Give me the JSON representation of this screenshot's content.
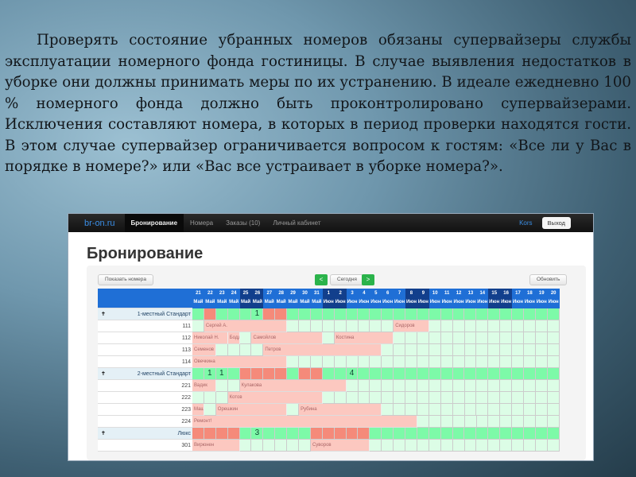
{
  "slide": {
    "paragraph": "Проверять состояние убранных номеров обязаны супервайзеры службы эксплуатации номерного фонда гостиницы. В случае выявления недостатков в уборке они должны принимать меры по их устранению. В идеале ежедневно 100 % номерного фонда должно быть проконтролировано супервайзерами. Исключения составляют номера, в которых в период проверки находятся гости. В этом случае супервайзер ограничивается вопросом к гостям: «Все ли у Вас в порядке в номере?» или «Вас все устраивает в уборке номера?»."
  },
  "app": {
    "brand": "br-on.ru",
    "nav": [
      "Бронирование",
      "Номера",
      "Заказы (10)",
      "Личный кабинет"
    ],
    "user": "Kors",
    "logout": "Выход",
    "title": "Бронирование",
    "show_rooms": "Показать номера",
    "prev": "<",
    "today": "Сегодня",
    "next": ">",
    "refresh": "Обновить",
    "days": [
      {
        "n": "21",
        "m": "Май"
      },
      {
        "n": "22",
        "m": "Май"
      },
      {
        "n": "23",
        "m": "Май"
      },
      {
        "n": "24",
        "m": "Май"
      },
      {
        "n": "25",
        "m": "Май",
        "we": true
      },
      {
        "n": "26",
        "m": "Май",
        "we": true
      },
      {
        "n": "27",
        "m": "Май"
      },
      {
        "n": "28",
        "m": "Май"
      },
      {
        "n": "29",
        "m": "Май"
      },
      {
        "n": "30",
        "m": "Май"
      },
      {
        "n": "31",
        "m": "Май"
      },
      {
        "n": "1",
        "m": "Июн",
        "we": true
      },
      {
        "n": "2",
        "m": "Июн",
        "we": true
      },
      {
        "n": "3",
        "m": "Июн"
      },
      {
        "n": "4",
        "m": "Июн"
      },
      {
        "n": "5",
        "m": "Июн"
      },
      {
        "n": "6",
        "m": "Июн"
      },
      {
        "n": "7",
        "m": "Июн"
      },
      {
        "n": "8",
        "m": "Июн",
        "we": true
      },
      {
        "n": "9",
        "m": "Июн",
        "we": true
      },
      {
        "n": "10",
        "m": "Июн"
      },
      {
        "n": "11",
        "m": "Июн"
      },
      {
        "n": "12",
        "m": "Июн"
      },
      {
        "n": "13",
        "m": "Июн"
      },
      {
        "n": "14",
        "m": "Июн"
      },
      {
        "n": "15",
        "m": "Июн",
        "we": true
      },
      {
        "n": "16",
        "m": "Июн",
        "we": true
      },
      {
        "n": "17",
        "m": "Июн"
      },
      {
        "n": "18",
        "m": "Июн"
      },
      {
        "n": "19",
        "m": "Июн"
      },
      {
        "n": "20",
        "m": "Июн"
      }
    ],
    "rows": [
      {
        "type": "cat",
        "label": "1-местный Стандарт",
        "cells": "grgggGrrggggggggggggggggggggggg",
        "nums": {
          "5": "1"
        }
      },
      {
        "type": "room",
        "label": "111",
        "bookings": [
          {
            "s": 1,
            "e": 7,
            "name": "Сергей А."
          },
          {
            "s": 17,
            "e": 19,
            "name": "Сидоров"
          }
        ]
      },
      {
        "type": "room",
        "label": "112",
        "bookings": [
          {
            "s": 0,
            "e": 2,
            "name": "Николай Н."
          },
          {
            "s": 3,
            "e": 3,
            "name": "Бодд"
          },
          {
            "s": 5,
            "e": 10,
            "name": "Самойлов"
          },
          {
            "s": 12,
            "e": 16,
            "name": "Костина"
          }
        ]
      },
      {
        "type": "room",
        "label": "113",
        "bookings": [
          {
            "s": 0,
            "e": 1,
            "name": "Семенов"
          },
          {
            "s": 6,
            "e": 15,
            "name": "Петров"
          }
        ]
      },
      {
        "type": "room",
        "label": "114",
        "bookings": [
          {
            "s": 0,
            "e": 7,
            "name": "Овечкина"
          }
        ]
      },
      {
        "type": "cat",
        "label": "2-местный Стандарт",
        "cells": "ggggrrrrgrrgggggggggggggggggggg",
        "nums": {
          "1": "1",
          "2": "1",
          "13": "4"
        }
      },
      {
        "type": "room",
        "label": "221",
        "bookings": [
          {
            "s": 0,
            "e": 1,
            "name": "Вадик"
          },
          {
            "s": 4,
            "e": 12,
            "name": "Кулакова"
          }
        ]
      },
      {
        "type": "room",
        "label": "222",
        "bookings": [
          {
            "s": 3,
            "e": 10,
            "name": "Котов"
          }
        ]
      },
      {
        "type": "room",
        "label": "223",
        "bookings": [
          {
            "s": 0,
            "e": 0,
            "name": "Маш"
          },
          {
            "s": 2,
            "e": 7,
            "name": "Орешкин"
          },
          {
            "s": 9,
            "e": 15,
            "name": "Рубина"
          }
        ]
      },
      {
        "type": "room",
        "label": "224",
        "bookings": [
          {
            "s": 0,
            "e": 18,
            "name": "Ремонт!"
          }
        ]
      },
      {
        "type": "cat",
        "label": "Люкс",
        "cells": "rrrrggggggrrrrrgggggggggggggggg",
        "nums": {
          "5": "3"
        }
      },
      {
        "type": "room",
        "label": "301",
        "bookings": [
          {
            "s": 0,
            "e": 3,
            "name": "Вирюнен"
          },
          {
            "s": 10,
            "e": 14,
            "name": "Суворов"
          }
        ]
      }
    ]
  },
  "colors": {
    "free": "#dcfde6",
    "available": "#7dfaa8",
    "full": "#f58a7a",
    "booked": "#fcc8c0",
    "header": "#1f6fd6"
  }
}
